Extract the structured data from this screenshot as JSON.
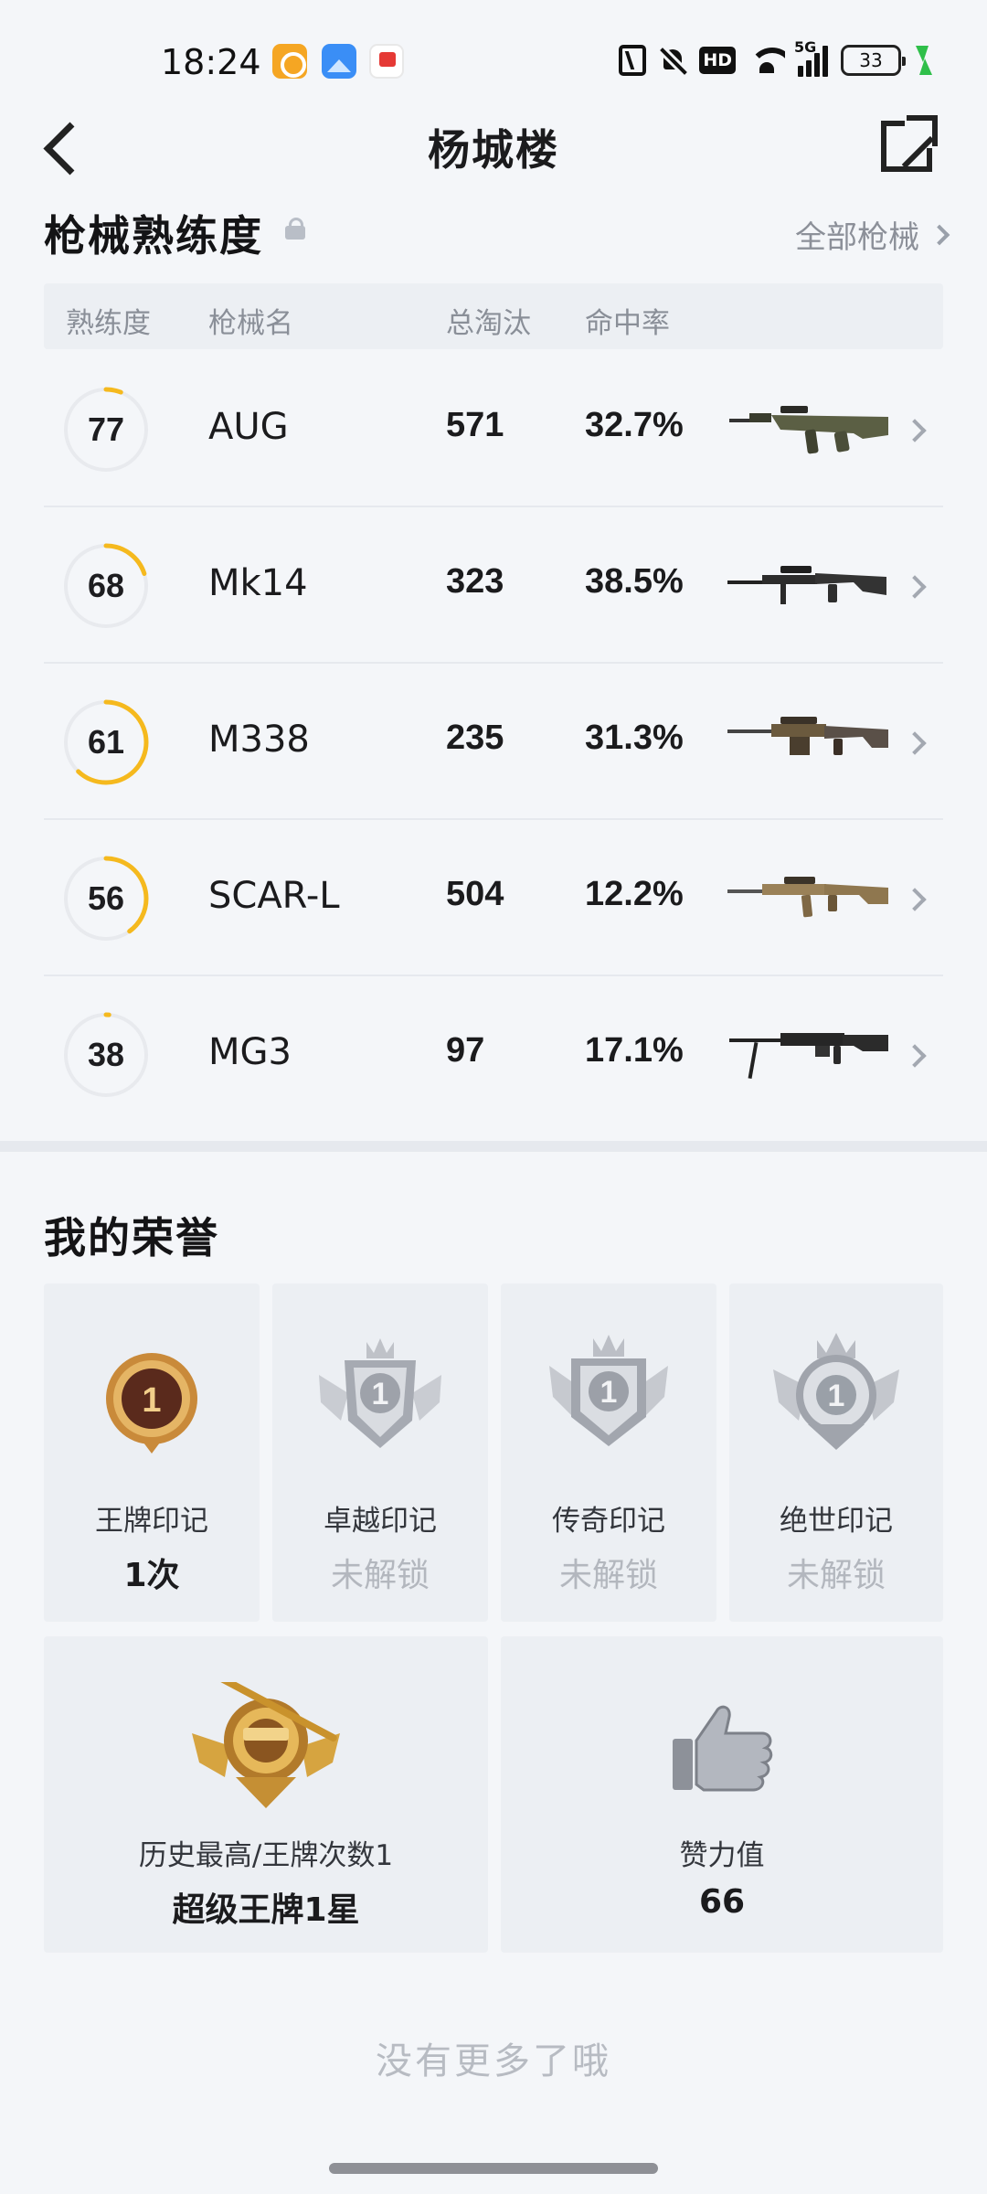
{
  "status_bar": {
    "time": "18:24",
    "battery": "33",
    "network": "5G"
  },
  "nav": {
    "title": "杨城楼"
  },
  "mastery": {
    "title": "枪械熟练度",
    "all_link": "全部枪械",
    "columns": [
      "熟练度",
      "枪械名",
      "总淘汰",
      "命中率"
    ],
    "rows": [
      {
        "level": "77",
        "name": "AUG",
        "eliminations": "571",
        "hit_rate": "32.7%",
        "ring_fill": 0.06
      },
      {
        "level": "68",
        "name": "Mk14",
        "eliminations": "323",
        "hit_rate": "38.5%",
        "ring_fill": 0.2
      },
      {
        "level": "61",
        "name": "M338",
        "eliminations": "235",
        "hit_rate": "31.3%",
        "ring_fill": 0.62
      },
      {
        "level": "56",
        "name": "SCAR-L",
        "eliminations": "504",
        "hit_rate": "12.2%",
        "ring_fill": 0.4
      },
      {
        "level": "38",
        "name": "MG3",
        "eliminations": "97",
        "hit_rate": "17.1%",
        "ring_fill": 0.01
      }
    ]
  },
  "honors": {
    "title": "我的荣誉",
    "marks": [
      {
        "label": "王牌印记",
        "value": "1次",
        "badge_number": "1",
        "locked": false
      },
      {
        "label": "卓越印记",
        "value": "未解锁",
        "badge_number": "1",
        "locked": true
      },
      {
        "label": "传奇印记",
        "value": "未解锁",
        "badge_number": "1",
        "locked": true
      },
      {
        "label": "绝世印记",
        "value": "未解锁",
        "badge_number": "1",
        "locked": true
      }
    ],
    "highest": {
      "label": "历史最高/王牌次数1",
      "value": "超级王牌1星"
    },
    "likes": {
      "label": "赞力值",
      "value": "66"
    }
  },
  "footer": {
    "end_text": "没有更多了哦"
  },
  "colors": {
    "accent": "#f5b91e",
    "ring_track": "#e8eaee",
    "background": "#f4f6f9"
  },
  "icons": [
    "back-icon",
    "share-icon",
    "lock-icon",
    "chevron-right-icon",
    "thumbs-up-icon"
  ]
}
